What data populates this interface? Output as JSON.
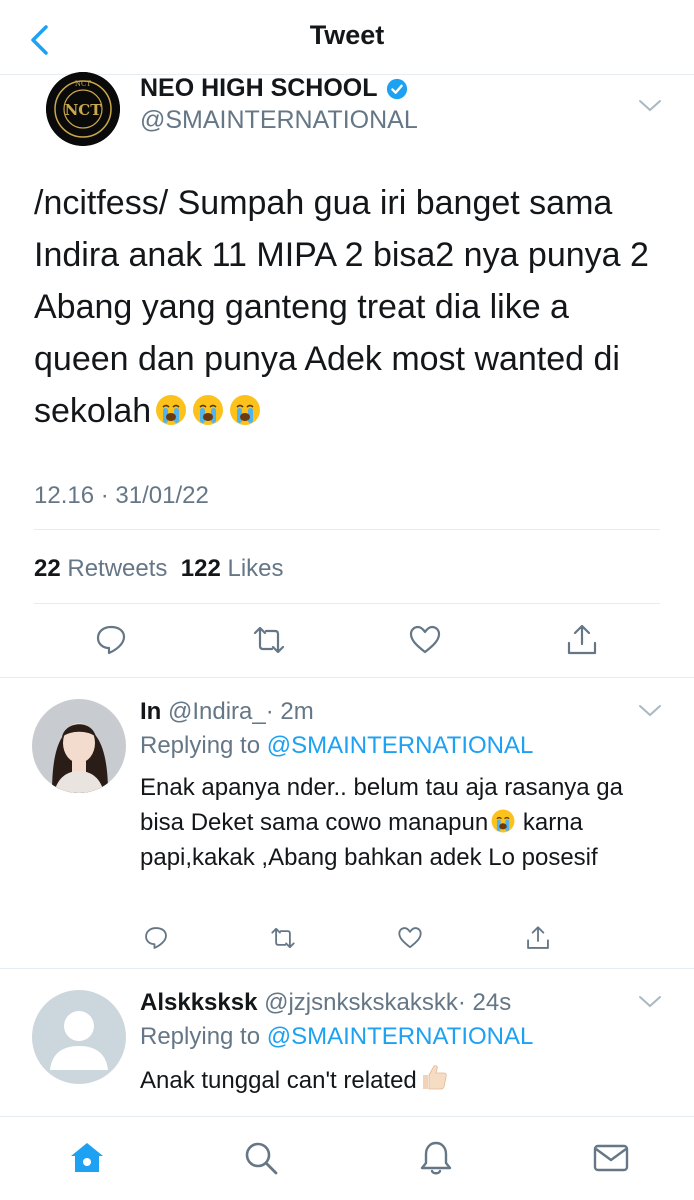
{
  "nav": {
    "title": "Tweet"
  },
  "main_tweet": {
    "name": "NEO HIGH SCHOOL",
    "handle": "@SMAINTERNATIONAL",
    "text": "/ncitfess/ Sumpah gua iri banget sama Indira anak 11 MIPA 2 bisa2 nya punya 2 Abang yang ganteng treat dia like a queen dan punya Adek most wanted di sekolah",
    "time": "12.16 · 31/01/22",
    "retweets_count": "22",
    "retweets_label": "Retweets",
    "likes_count": "122",
    "likes_label": "Likes",
    "avatar_logo": {
      "top": "NCT",
      "monogram": "NCT",
      "ring": "NEO CULTURE TECHNOLOGY"
    }
  },
  "replies": [
    {
      "name": "In",
      "handle": "@Indira_",
      "time": "· 2m",
      "replying_prefix": "Replying to",
      "replying_to": "@SMAINTERNATIONAL",
      "text_part1": "Enak apanya nder.. belum tau aja rasanya ga bisa Deket sama cowo manapun",
      "text_part2": "karna papi,kakak ,Abang bahkan adek Lo posesif"
    },
    {
      "name": "Alskksksk",
      "handle": "@jzjsnkskskakskk",
      "time": "· 24s",
      "replying_prefix": "Replying to",
      "replying_to": "@SMAINTERNATIONAL",
      "text": "Anak tunggal can't related"
    }
  ],
  "colors": {
    "accent": "#1da1f2",
    "text": "#14171a",
    "muted": "#657786",
    "border": "#e6ecf0"
  },
  "icons": [
    "back-chevron-icon",
    "verified-badge-icon",
    "reply-icon",
    "retweet-icon",
    "like-icon",
    "share-icon",
    "home-icon",
    "search-icon",
    "notifications-icon",
    "messages-icon"
  ]
}
